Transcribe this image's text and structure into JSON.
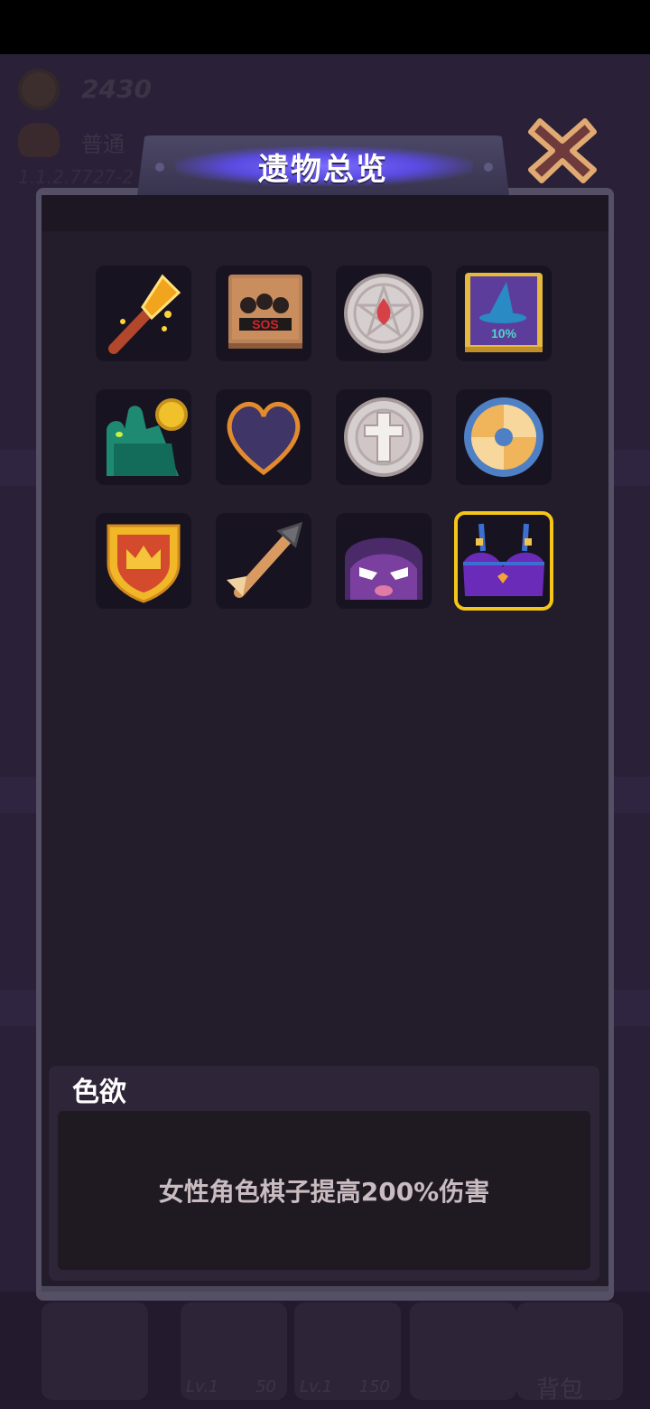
{
  "hud": {
    "gold": "2430",
    "difficulty": "普通",
    "version": "1.1.2.7727-2"
  },
  "modal": {
    "title": "遗物总览",
    "close_icon": "close-x-icon"
  },
  "relics": [
    {
      "icon": "flame-spear-icon"
    },
    {
      "icon": "sos-book-icon"
    },
    {
      "icon": "pentagram-blood-coin-icon"
    },
    {
      "icon": "wizard-hat-tome-icon"
    },
    {
      "icon": "zombie-hand-coin-icon"
    },
    {
      "icon": "purple-heart-icon"
    },
    {
      "icon": "cross-coin-icon"
    },
    {
      "icon": "round-shield-icon"
    },
    {
      "icon": "crown-shield-icon"
    },
    {
      "icon": "stone-arrow-icon"
    },
    {
      "icon": "angry-hood-icon"
    },
    {
      "icon": "purple-bra-icon",
      "selected": true
    }
  ],
  "selected_relic": {
    "name": "色欲",
    "description": "女性角色棋子提高200%伤害"
  },
  "bottom_bar": {
    "cards": [
      {
        "lv": "Lv.1",
        "cost": "50"
      },
      {
        "lv": "Lv.1",
        "cost": "150"
      }
    ],
    "bag_label": "背包"
  },
  "colors": {
    "accent_selected": "#f5c518",
    "panel_bg": "#221c2b",
    "title_glow": "#7b6cff"
  }
}
